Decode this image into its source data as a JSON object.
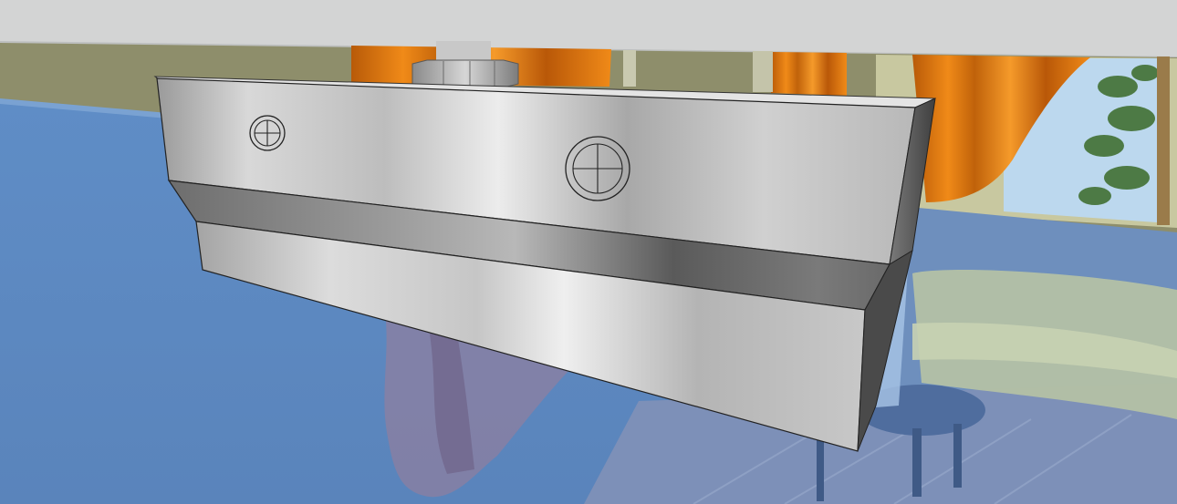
{
  "scene": {
    "subject": "stainless-steel-glass-door-patch-fitting",
    "colors": {
      "ceiling": "#d2d4d4",
      "wall": "#8f8f6c",
      "glass": "#5f8cc2",
      "curtain": "#e07a10",
      "curtain_dark": "#a84e06",
      "steel_light": "#e4e4e4",
      "steel_mid": "#a9a9a9",
      "steel_dark": "#5c5c5c",
      "sofa": "#b9c7a6",
      "floor": "#7b8fb8",
      "foliage": "#4f7a46",
      "sky": "#b9d6ef"
    },
    "icons": [
      "crosshair-screw-icon",
      "crosshair-screw-icon"
    ]
  }
}
